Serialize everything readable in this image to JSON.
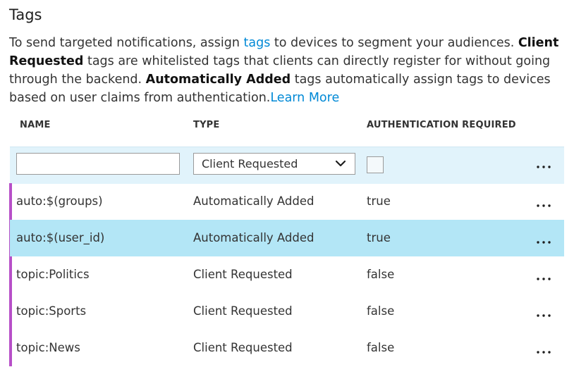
{
  "section": {
    "title": "Tags",
    "desc_intro": "To send targeted notifications, assign ",
    "desc_link_tags": "tags",
    "desc_mid1": " to devices to segment your audiences. ",
    "desc_bold_client": "Client Requested",
    "desc_mid2": " tags are whitelisted tags that clients can directly register for without going through the backend. ",
    "desc_bold_auto": "Automatically Added",
    "desc_mid3": " tags automatically assign tags to devices based on user claims from authentication.",
    "desc_link_learn": "Learn More"
  },
  "columns": {
    "name": "NAME",
    "type": "TYPE",
    "auth": "AUTHENTICATION REQUIRED"
  },
  "new_row": {
    "name_value": "",
    "name_placeholder": "",
    "type_selected": "Client Requested",
    "auth_checked": false
  },
  "rows": [
    {
      "name": "auto:$(groups)",
      "type": "Automatically Added",
      "auth": "true"
    },
    {
      "name": "auto:$(user_id)",
      "type": "Automatically Added",
      "auth": "true"
    },
    {
      "name": "topic:Politics",
      "type": "Client Requested",
      "auth": "false"
    },
    {
      "name": "topic:Sports",
      "type": "Client Requested",
      "auth": "false"
    },
    {
      "name": "topic:News",
      "type": "Client Requested",
      "auth": "false"
    }
  ],
  "selected_row_index": 1,
  "icons": {
    "more": "more-ellipsis-icon",
    "dropdown": "chevron-down-icon"
  },
  "colors": {
    "link": "#0089d6",
    "new_row_bg": "#e1f3fb",
    "selected_row_bg": "#b3e6f6",
    "accent_bar": "#b750c8"
  }
}
